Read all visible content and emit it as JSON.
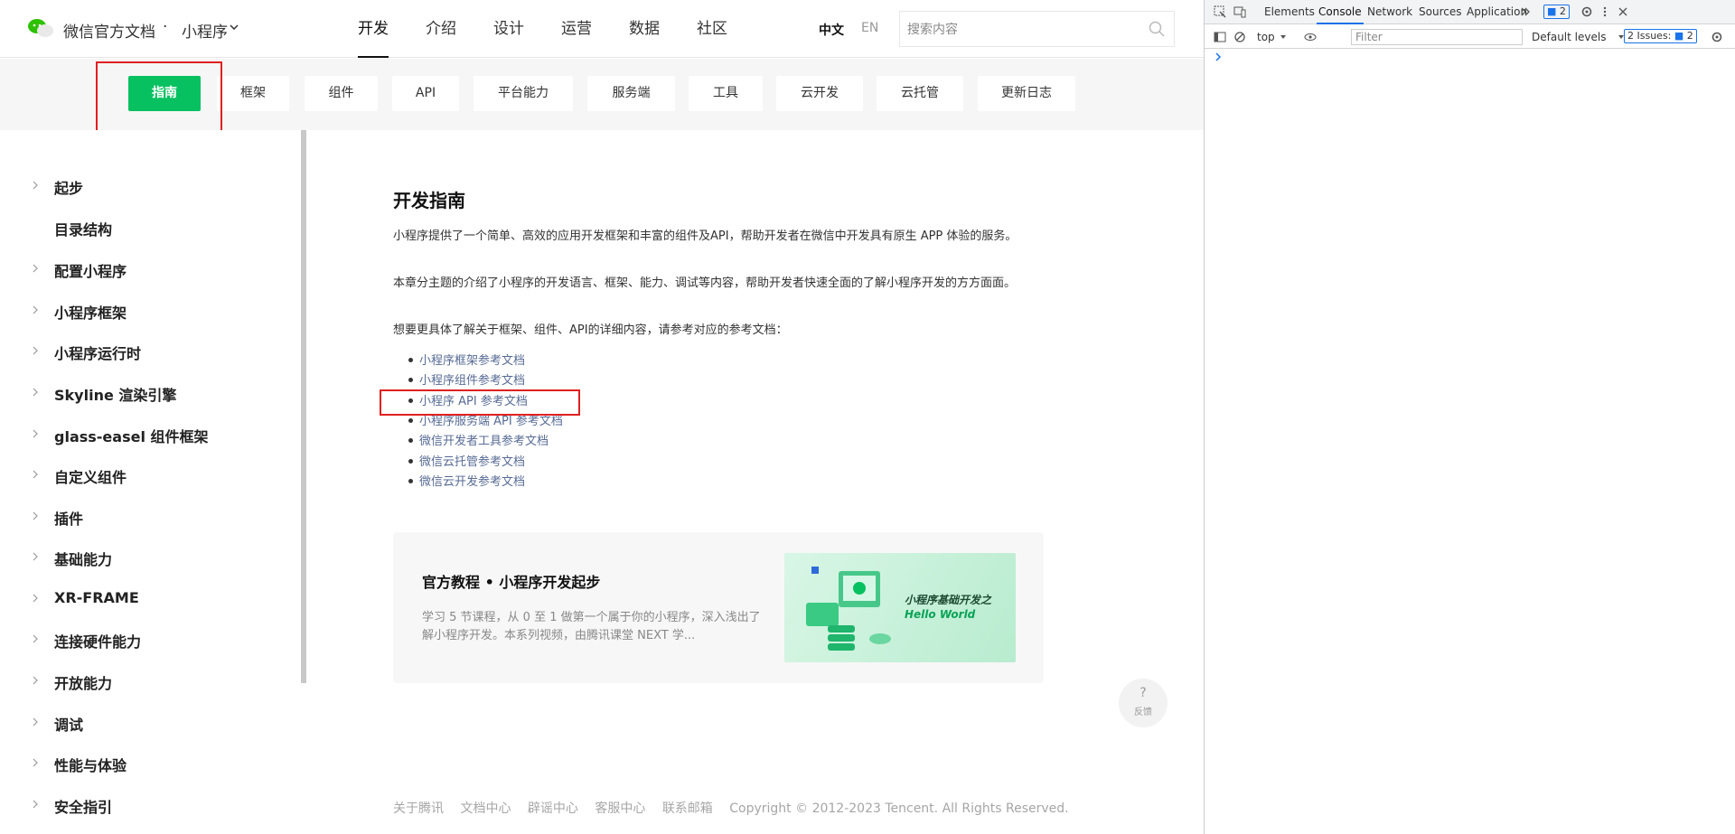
{
  "topnav": {
    "brand": "微信官方文档",
    "dot": "·",
    "sub": "小程序",
    "items": [
      "开发",
      "介绍",
      "设计",
      "运营",
      "数据",
      "社区"
    ],
    "lang_zh": "中文",
    "lang_en": "EN",
    "search_placeholder": "搜索内容"
  },
  "subnav": {
    "tabs": [
      "指南",
      "框架",
      "组件",
      "API",
      "平台能力",
      "服务端",
      "工具",
      "云开发",
      "云托管",
      "更新日志"
    ]
  },
  "sidebar": {
    "items": [
      "起步",
      "目录结构",
      "配置小程序",
      "小程序框架",
      "小程序运行时",
      "Skyline 渲染引擎",
      "glass-easel 组件框架",
      "自定义组件",
      "插件",
      "基础能力",
      "XR-FRAME",
      "连接硬件能力",
      "开放能力",
      "调试",
      "性能与体验",
      "安全指引"
    ]
  },
  "content": {
    "title": "开发指南",
    "p1": "小程序提供了一个简单、高效的应用开发框架和丰富的组件及API，帮助开发者在微信中开发具有原生 APP 体验的服务。",
    "p2": "本章分主题的介绍了小程序的开发语言、框架、能力、调试等内容，帮助开发者快速全面的了解小程序开发的方方面面。",
    "p3": "想要更具体了解关于框架、组件、API的详细内容，请参考对应的参考文档：",
    "links": [
      "小程序框架参考文档",
      "小程序组件参考文档",
      "小程序 API 参考文档",
      "小程序服务端 API 参考文档",
      "微信开发者工具参考文档",
      "微信云托管参考文档",
      "微信云开发参考文档"
    ],
    "card_title": "官方教程 • 小程序开发起步",
    "card_desc": "学习 5 节课程，从 0 至 1 做第一个属于你的小程序，深入浅出了解小程序开发。本系列视频，由腾讯课堂 NEXT 学...",
    "card_img_line1": "小程序基础开发之",
    "card_img_line2": "Hello World"
  },
  "feedback": {
    "q": "?",
    "label": "反馈"
  },
  "footer": {
    "links": [
      "关于腾讯",
      "文档中心",
      "辟谣中心",
      "客服中心",
      "联系邮箱"
    ],
    "copyright": "Copyright © 2012-2023 Tencent. All Rights Reserved."
  },
  "devtools": {
    "tabs": [
      "Elements",
      "Console",
      "Network",
      "Sources",
      "Application"
    ],
    "messages_badge": "2",
    "context": "top",
    "filter_placeholder": "Filter",
    "levels": "Default levels",
    "issues": "2 Issues:",
    "issues_count": "2"
  },
  "colors": {
    "accent": "#07c160",
    "link": "#576b95",
    "highlight": "#e02020"
  }
}
